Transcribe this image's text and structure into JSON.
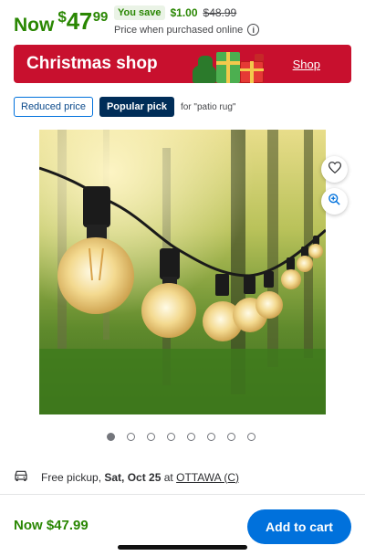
{
  "price": {
    "now_word": "Now",
    "currency": "$",
    "dollars": "47",
    "cents": "99",
    "save_badge": "You save",
    "save_amount": "$1.00",
    "was_price": "$48.99",
    "note": "Price when purchased online",
    "info_icon": "info-icon"
  },
  "banner": {
    "title": "Christmas shop",
    "link": "Shop",
    "color": "#c8102e"
  },
  "tags": {
    "reduced": "Reduced price",
    "popular": "Popular pick",
    "for_text": "for \"patio rug\""
  },
  "image": {
    "favorite_icon": "heart-icon",
    "zoom_icon": "zoom-in-icon",
    "dot_count": 8,
    "active_index": 0
  },
  "pickup": {
    "icon": "car-icon",
    "label": "Free pickup,",
    "date": "Sat, Oct 25",
    "at": "at",
    "store": "OTTAWA (C)"
  },
  "bottom_bar": {
    "price": "Now $47.99",
    "cart_button": "Add to cart"
  },
  "colors": {
    "accent": "#0071dc",
    "price_green": "#2a8703",
    "dark_tag": "#002d58"
  }
}
